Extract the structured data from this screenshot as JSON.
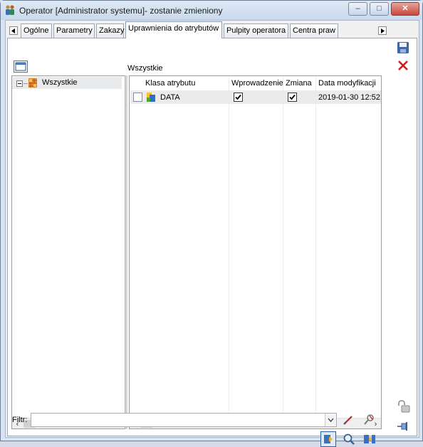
{
  "window": {
    "title": "Operator [Administrator systemu]- zostanie zmieniony",
    "minimize_glyph": "–",
    "maximize_glyph": "□",
    "close_glyph": "✕"
  },
  "tabs": [
    {
      "label": "Ogólne",
      "active": false
    },
    {
      "label": "Parametry",
      "active": false
    },
    {
      "label": "Zakazy",
      "active": false
    },
    {
      "label": "Uprawnienia do atrybutów",
      "active": true
    },
    {
      "label": "Pulpity operatora",
      "active": false
    },
    {
      "label": "Centra praw",
      "active": false
    }
  ],
  "tree": {
    "root_label": "Wszystkie",
    "expander_state": "collapsed"
  },
  "grid": {
    "caption": "Wszystkie",
    "columns": [
      "Klasa atrybutu",
      "Wprowadzenie",
      "Zmiana",
      "Data modyfikacji"
    ],
    "rows": [
      {
        "selected": false,
        "class": "DATA",
        "entry": true,
        "change": true,
        "modified": "2019-01-30 12:52:..."
      }
    ]
  },
  "filter": {
    "label": "Filtr:",
    "value": ""
  },
  "icons": {
    "save": "save-icon",
    "cancel": "cancel-icon",
    "clear_filter": "clear-filter-icon",
    "filter_settings": "filter-settings-icon",
    "apply": "apply-filter-icon",
    "search": "magnifier-icon",
    "attach": "attach-icon",
    "lock": "lock-icon",
    "pin": "pin-icon"
  },
  "colors": {
    "title_bar": "#c9d9ec",
    "close_button": "#c7463a",
    "cancel_red": "#d21b1b",
    "row_highlight": "#ebebeb"
  }
}
